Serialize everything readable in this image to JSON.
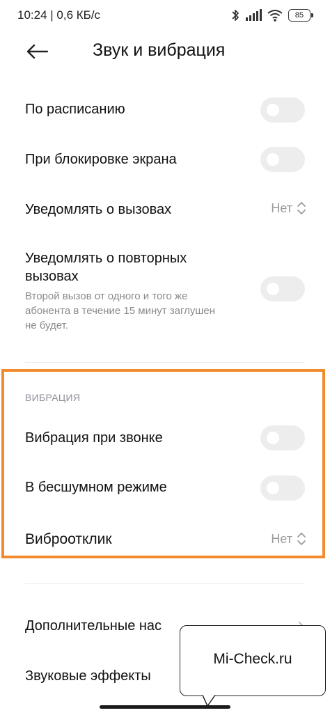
{
  "status_bar": {
    "time_speed": "10:24 | 0,6 КБ/с",
    "battery": "85",
    "icons": [
      "bluetooth-icon",
      "signal-icon",
      "wifi-icon",
      "battery-icon"
    ]
  },
  "header": {
    "title": "Звук и вибрация",
    "back_icon": "arrow-left-icon"
  },
  "settings": [
    {
      "label": "По расписанию",
      "control": "toggle",
      "on": false
    },
    {
      "label": "При блокировке экрана",
      "control": "toggle",
      "on": false
    },
    {
      "label": "Уведомлять о вызовах",
      "control": "select",
      "value": "Нет"
    },
    {
      "label_line1": "Уведомлять о повторных",
      "label_line2": "вызовах",
      "description_line1": "Второй вызов от одного и того же",
      "description_line2": "абонента в течение 15 минут заглушен",
      "description_line3": "не будет.",
      "control": "toggle",
      "on": false
    }
  ],
  "vibration_section": {
    "title": "ВИБРАЦИЯ",
    "items": [
      {
        "label": "Вибрация при звонке",
        "control": "toggle",
        "on": false
      },
      {
        "label": "В бесшумном режиме",
        "control": "toggle",
        "on": false
      },
      {
        "label": "Виброотклик",
        "control": "select",
        "value": "Нет"
      }
    ]
  },
  "more": [
    {
      "label": "Дополнительные нас"
    },
    {
      "label": "Звуковые эффекты"
    }
  ],
  "watermark": {
    "text": "Mi-Check.ru"
  },
  "colors": {
    "highlight": "#f28a2e",
    "toggle_off": "#ededed",
    "secondary_text": "#8a8a8a"
  }
}
